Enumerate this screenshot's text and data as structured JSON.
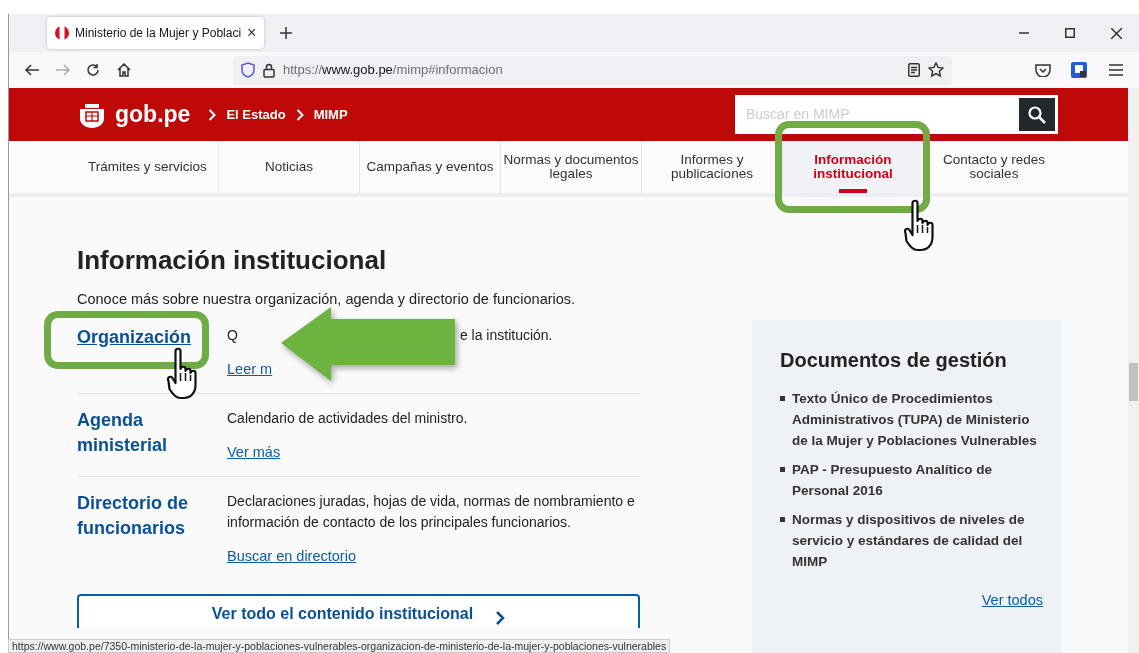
{
  "browser": {
    "tab": {
      "title": "Ministerio de la Mujer y Poblaci",
      "close": "×"
    },
    "url": {
      "scheme": "https://",
      "host": "www.gob.pe",
      "path": "/mimp#informacion"
    }
  },
  "header": {
    "logo_text": "gob.pe",
    "breadcrumb": [
      "El Estado",
      "MIMP"
    ],
    "search": {
      "placeholder": "Buscar en MIMP"
    }
  },
  "nav": [
    {
      "label": "Trámites y servicios",
      "selected": false
    },
    {
      "label": "Noticias",
      "selected": false
    },
    {
      "label": "Campañas y eventos",
      "selected": false
    },
    {
      "label": "Normas y documentos legales",
      "selected": false
    },
    {
      "label": "Informes y publicaciones",
      "selected": false
    },
    {
      "label": "Información institucional",
      "selected": true
    },
    {
      "label": "Contacto y redes sociales",
      "selected": false
    }
  ],
  "section": {
    "title": "Información institucional",
    "intro": "Conoce más sobre nuestra organización, agenda y directorio de funcionarios.",
    "items": [
      {
        "title": "Organización",
        "hovered": true,
        "description": [
          "Q",
          "e la institución."
        ],
        "link": "Leer m"
      },
      {
        "title": "Agenda ministerial",
        "hovered": false,
        "description": [
          "Calendario de actividades del ministro."
        ],
        "link": "Ver más"
      },
      {
        "title": "Directorio de funcionarios",
        "hovered": false,
        "description": [
          "Declaraciones juradas, hojas de vida, normas de nombramiento e información de contacto de los principales funcionarios."
        ],
        "link": "Buscar en directorio"
      }
    ],
    "all_link": "Ver todo el contenido institucional"
  },
  "documents": {
    "title": "Documentos de gestión",
    "items": [
      "Texto Único de Procedimientos Administrativos (TUPA) de Ministerio de la Mujer y Poblaciones Vulnerables",
      "PAP - Presupuesto Analítico de Personal 2016",
      "Normas y dispositivos de niveles de servicio y estándares de calidad del MIMP"
    ],
    "link": "Ver todos"
  },
  "status_url": "https://www.gob.pe/7350-ministerio-de-la-mujer-y-poblaciones-vulnerables-organizacion-de-ministerio-de-la-mujer-y-poblaciones-vulnerables"
}
